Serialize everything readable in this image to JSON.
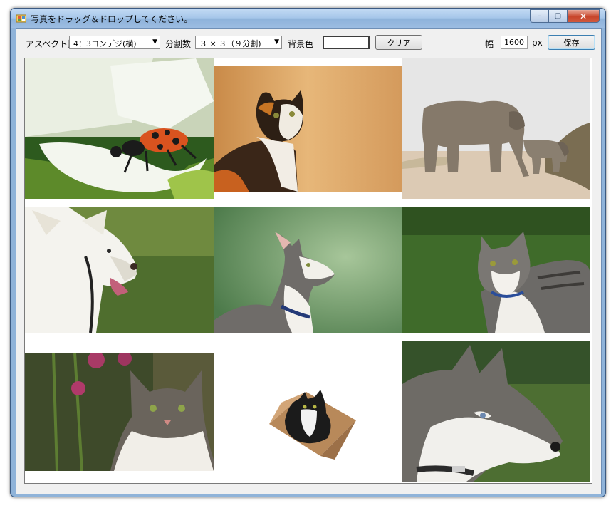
{
  "window": {
    "title": "写真をドラッグ＆ドロップしてください。",
    "controls": {
      "minimize": "–",
      "maximize": "▢",
      "close": "✕"
    }
  },
  "toolbar": {
    "aspect_label": "アスペクト比",
    "aspect_value": "4：3コンデジ(横)",
    "divide_label": "分割数",
    "divide_value": "３ × ３（９分割)",
    "bg_label": "背景色",
    "bg_color": "#ffffff",
    "clear_button": "クリア",
    "width_label": "幅",
    "width_value": "1600",
    "unit_label": "px",
    "save_button": "保存"
  },
  "grid": {
    "rows": 3,
    "columns": 3,
    "photos": [
      {
        "subject": "ladybug-beetle-on-flower"
      },
      {
        "subject": "calico-cat"
      },
      {
        "subject": "elephants"
      },
      {
        "subject": "white-dog"
      },
      {
        "subject": "cat-looking-up"
      },
      {
        "subject": "tabby-cat-on-grass"
      },
      {
        "subject": "cat-with-flowers"
      },
      {
        "subject": "cat-in-box"
      },
      {
        "subject": "husky-dog"
      }
    ]
  }
}
